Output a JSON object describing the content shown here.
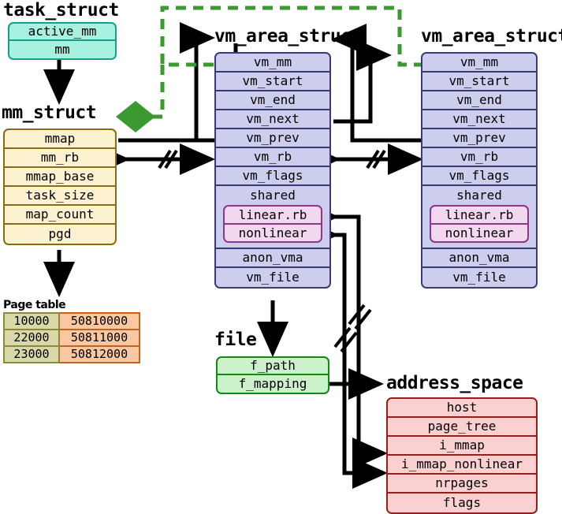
{
  "diagram": {
    "title_task": "task_struct",
    "title_mm": "mm_struct",
    "title_vma_left": "vm_area_struct",
    "title_vma_right": "vm_area_struct",
    "title_file": "file",
    "title_address_space": "address_space",
    "title_page_table": "Page table"
  },
  "task_struct": {
    "fields": [
      "active_mm",
      "mm"
    ]
  },
  "mm_struct": {
    "fields": [
      "mmap",
      "mm_rb",
      "mmap_base",
      "task_size",
      "map_count",
      "pgd"
    ]
  },
  "vma_left": {
    "fields_top": [
      "vm_mm",
      "vm_start",
      "vm_end",
      "vm_next",
      "vm_prev",
      "vm_rb",
      "vm_flags"
    ],
    "shared_label": "shared",
    "shared_nested": [
      "linear.rb",
      "nonlinear"
    ],
    "fields_bottom": [
      "anon_vma",
      "vm_file"
    ]
  },
  "vma_right": {
    "fields_top": [
      "vm_mm",
      "vm_start",
      "vm_end",
      "vm_next",
      "vm_prev",
      "vm_rb",
      "vm_flags"
    ],
    "shared_label": "shared",
    "shared_nested": [
      "linear.rb",
      "nonlinear"
    ],
    "fields_bottom": [
      "anon_vma",
      "vm_file"
    ]
  },
  "file": {
    "fields": [
      "f_path",
      "f_mapping"
    ]
  },
  "address_space": {
    "fields": [
      "host",
      "page_tree",
      "i_mmap",
      "i_mmap_nonlinear",
      "nrpages",
      "flags"
    ]
  },
  "page_table": {
    "rows": [
      {
        "virt": "10000",
        "phys": "50810000"
      },
      {
        "virt": "22000",
        "phys": "50811000"
      },
      {
        "virt": "23000",
        "phys": "50812000"
      }
    ]
  },
  "colors": {
    "task_fill": "#a8f0e0",
    "task_stroke": "#12a08c",
    "mm_fill": "#fcf2cf",
    "mm_stroke": "#8a6d10",
    "vma_fill": "#cdcdee",
    "vma_stroke": "#3a3a78",
    "nested_fill": "#f2d8ee",
    "nested_stroke": "#90348c",
    "file_fill": "#ccf2cc",
    "file_stroke": "#108a10",
    "address_space_fill": "#fad0d0",
    "address_space_stroke": "#9a1c1c",
    "pt_key_fill": "#d8d8a8",
    "pt_val_fill": "#fac8a0",
    "wire": "#000000",
    "wire_dashed": "#3a9a30"
  }
}
